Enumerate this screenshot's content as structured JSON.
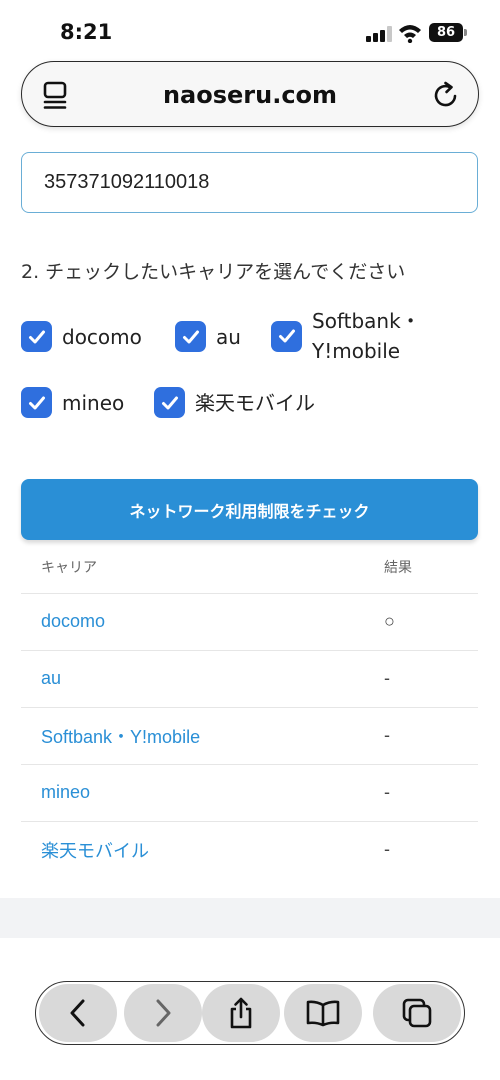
{
  "status_bar": {
    "time": "8:21",
    "battery": "86"
  },
  "browser": {
    "url": "naoseru.com"
  },
  "form": {
    "imei_value": "357371092110018",
    "heading": "2. チェックしたいキャリアを選んでください",
    "carriers": [
      {
        "label": "docomo",
        "checked": true
      },
      {
        "label": "au",
        "checked": true
      },
      {
        "label_line1": "Softbank・",
        "label_line2": "Y!mobile",
        "checked": true
      },
      {
        "label": "mineo",
        "checked": true
      },
      {
        "label": "楽天モバイル",
        "checked": true
      }
    ],
    "check_button_label": "ネットワーク利用制限をチェック"
  },
  "results": {
    "headers": {
      "carrier": "キャリア",
      "result": "結果"
    },
    "rows": [
      {
        "carrier": "docomo",
        "result": "○"
      },
      {
        "carrier": "au",
        "result": "-"
      },
      {
        "carrier": "Softbank・Y!mobile",
        "result": "-"
      },
      {
        "carrier": "mineo",
        "result": "-"
      },
      {
        "carrier": "楽天モバイル",
        "result": "-"
      }
    ]
  },
  "toolbar": {
    "buttons": [
      "back-icon",
      "forward-icon",
      "share-icon",
      "bookmarks-icon",
      "tabs-icon"
    ]
  },
  "colors": {
    "accent": "#2a8fd6",
    "checkbox": "#2f6fde",
    "link": "#2a8fd6"
  }
}
